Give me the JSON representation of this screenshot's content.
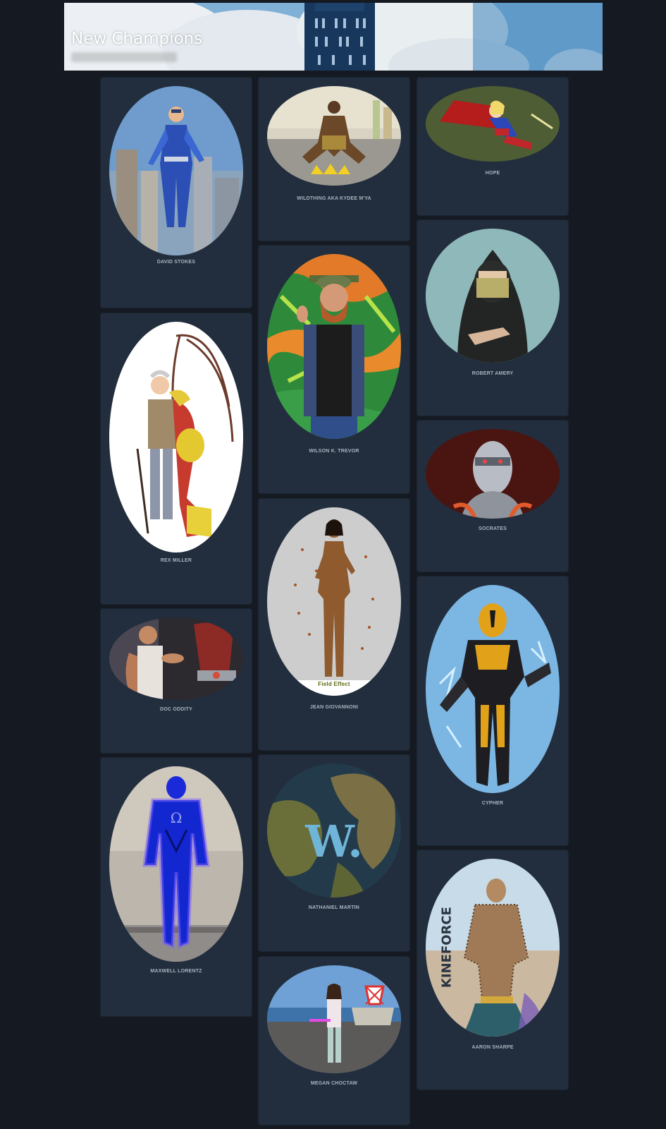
{
  "banner": {
    "title": "New Champions"
  },
  "champions": [
    {
      "name": "DAVID STOKES",
      "portrait": "flying-hero-city"
    },
    {
      "name": "WILDTHING AKA KYDEE M'YA",
      "portrait": "crouching-warrior"
    },
    {
      "name": "HOPE",
      "portrait": "flying-heroine-cape"
    },
    {
      "name": "ROBERT AMERY",
      "portrait": "hooded-masked-figure"
    },
    {
      "name": "REX MILLER",
      "portrait": "old-man-mech-arm-sketch"
    },
    {
      "name": "WILSON K. TREVOR",
      "portrait": "bearded-man-graffiti"
    },
    {
      "name": "SOCRATES",
      "portrait": "chrome-android-head"
    },
    {
      "name": "DOC ODDITY",
      "portrait": "man-with-gauntlet"
    },
    {
      "name": "JEAN GIOVANNONI",
      "portrait": "golden-woman-field-effect",
      "caption": "Field Effect"
    },
    {
      "name": "CYPHER",
      "portrait": "black-gold-armored-hero"
    },
    {
      "name": "MAXWELL LORENTZ",
      "portrait": "blue-omega-hero"
    },
    {
      "name": "NATHANIEL MARTIN",
      "portrait": "globe-w-logo"
    },
    {
      "name": "AARON SHARPE",
      "portrait": "kinetic-force-hero",
      "caption": "KINEFORCE"
    },
    {
      "name": "MEGAN CHOCTAW",
      "portrait": "woman-on-rooftop"
    }
  ]
}
